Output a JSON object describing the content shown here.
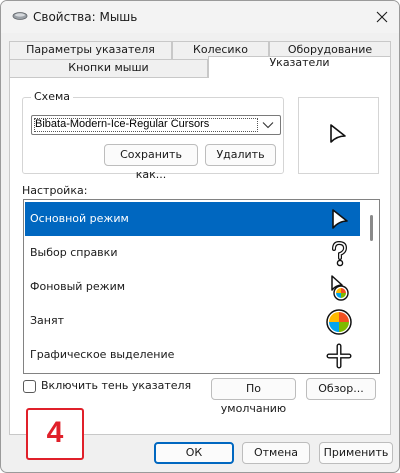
{
  "window": {
    "title": "Свойства: Мышь"
  },
  "tabs": {
    "row1": [
      {
        "label": "Параметры указателя"
      },
      {
        "label": "Колесико"
      },
      {
        "label": "Оборудование"
      }
    ],
    "row2": [
      {
        "label": "Кнопки мыши"
      },
      {
        "label": "Указатели"
      }
    ]
  },
  "scheme": {
    "legend": "Схема",
    "selected": "Bibata-Modern-Ice-Regular Cursors",
    "save_label": "Сохранить как...",
    "delete_label": "Удалить"
  },
  "settings": {
    "label": "Настройка:",
    "items": [
      {
        "label": "Основной режим",
        "icon": "arrow-cursor-icon"
      },
      {
        "label": "Выбор справки",
        "icon": "help-cursor-icon"
      },
      {
        "label": "Фоновый режим",
        "icon": "working-in-background-cursor-icon"
      },
      {
        "label": "Занят",
        "icon": "busy-cursor-icon"
      },
      {
        "label": "Графическое выделение",
        "icon": "precision-select-cursor-icon"
      }
    ]
  },
  "options": {
    "shadow_label": "Включить тень указателя",
    "shadow_checked": false,
    "default_label": "По умолчанию",
    "browse_label": "Обзор..."
  },
  "badge": {
    "text": "4"
  },
  "footer": {
    "ok_label": "ОК",
    "cancel_label": "Отмена",
    "apply_label": "Применить"
  },
  "colors": {
    "selection": "#0067c0",
    "badge_red": "#e0202a"
  }
}
